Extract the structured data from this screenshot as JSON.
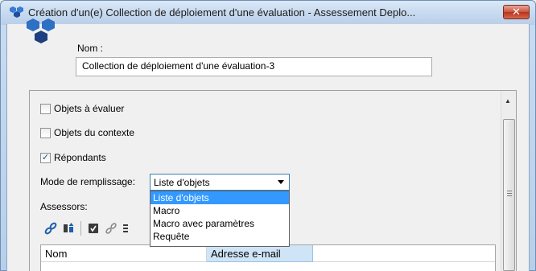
{
  "window": {
    "title": "Création d'un(e) Collection de déploiement d'une évaluation - Assessement Deplo...",
    "close_label": "✕"
  },
  "header": {
    "nom_label": "Nom :",
    "nom_value": "Collection de déploiement d'une évaluation-3"
  },
  "options": {
    "objets_a_evaluer": {
      "label": "Objets à évaluer",
      "checked": false
    },
    "objets_du_contexte": {
      "label": "Objets du contexte",
      "checked": false
    },
    "repondants": {
      "label": "Répondants",
      "checked": true
    }
  },
  "mode": {
    "label": "Mode de remplissage:",
    "selected": "Liste d'objets",
    "options": [
      "Liste d'objets",
      "Macro",
      "Macro avec paramètres",
      "Requête"
    ]
  },
  "assessors": {
    "label": "Assessors:",
    "toolbar_icons": [
      "link-icon",
      "import-icon",
      "checkbox-icon",
      "unlink-icon",
      "list-icon"
    ]
  },
  "table": {
    "columns": [
      "Nom",
      "Adresse e-mail"
    ]
  },
  "colors": {
    "selection": "#3399ff",
    "close_button": "#c9513b",
    "brand_blue": "#1f5fae"
  }
}
